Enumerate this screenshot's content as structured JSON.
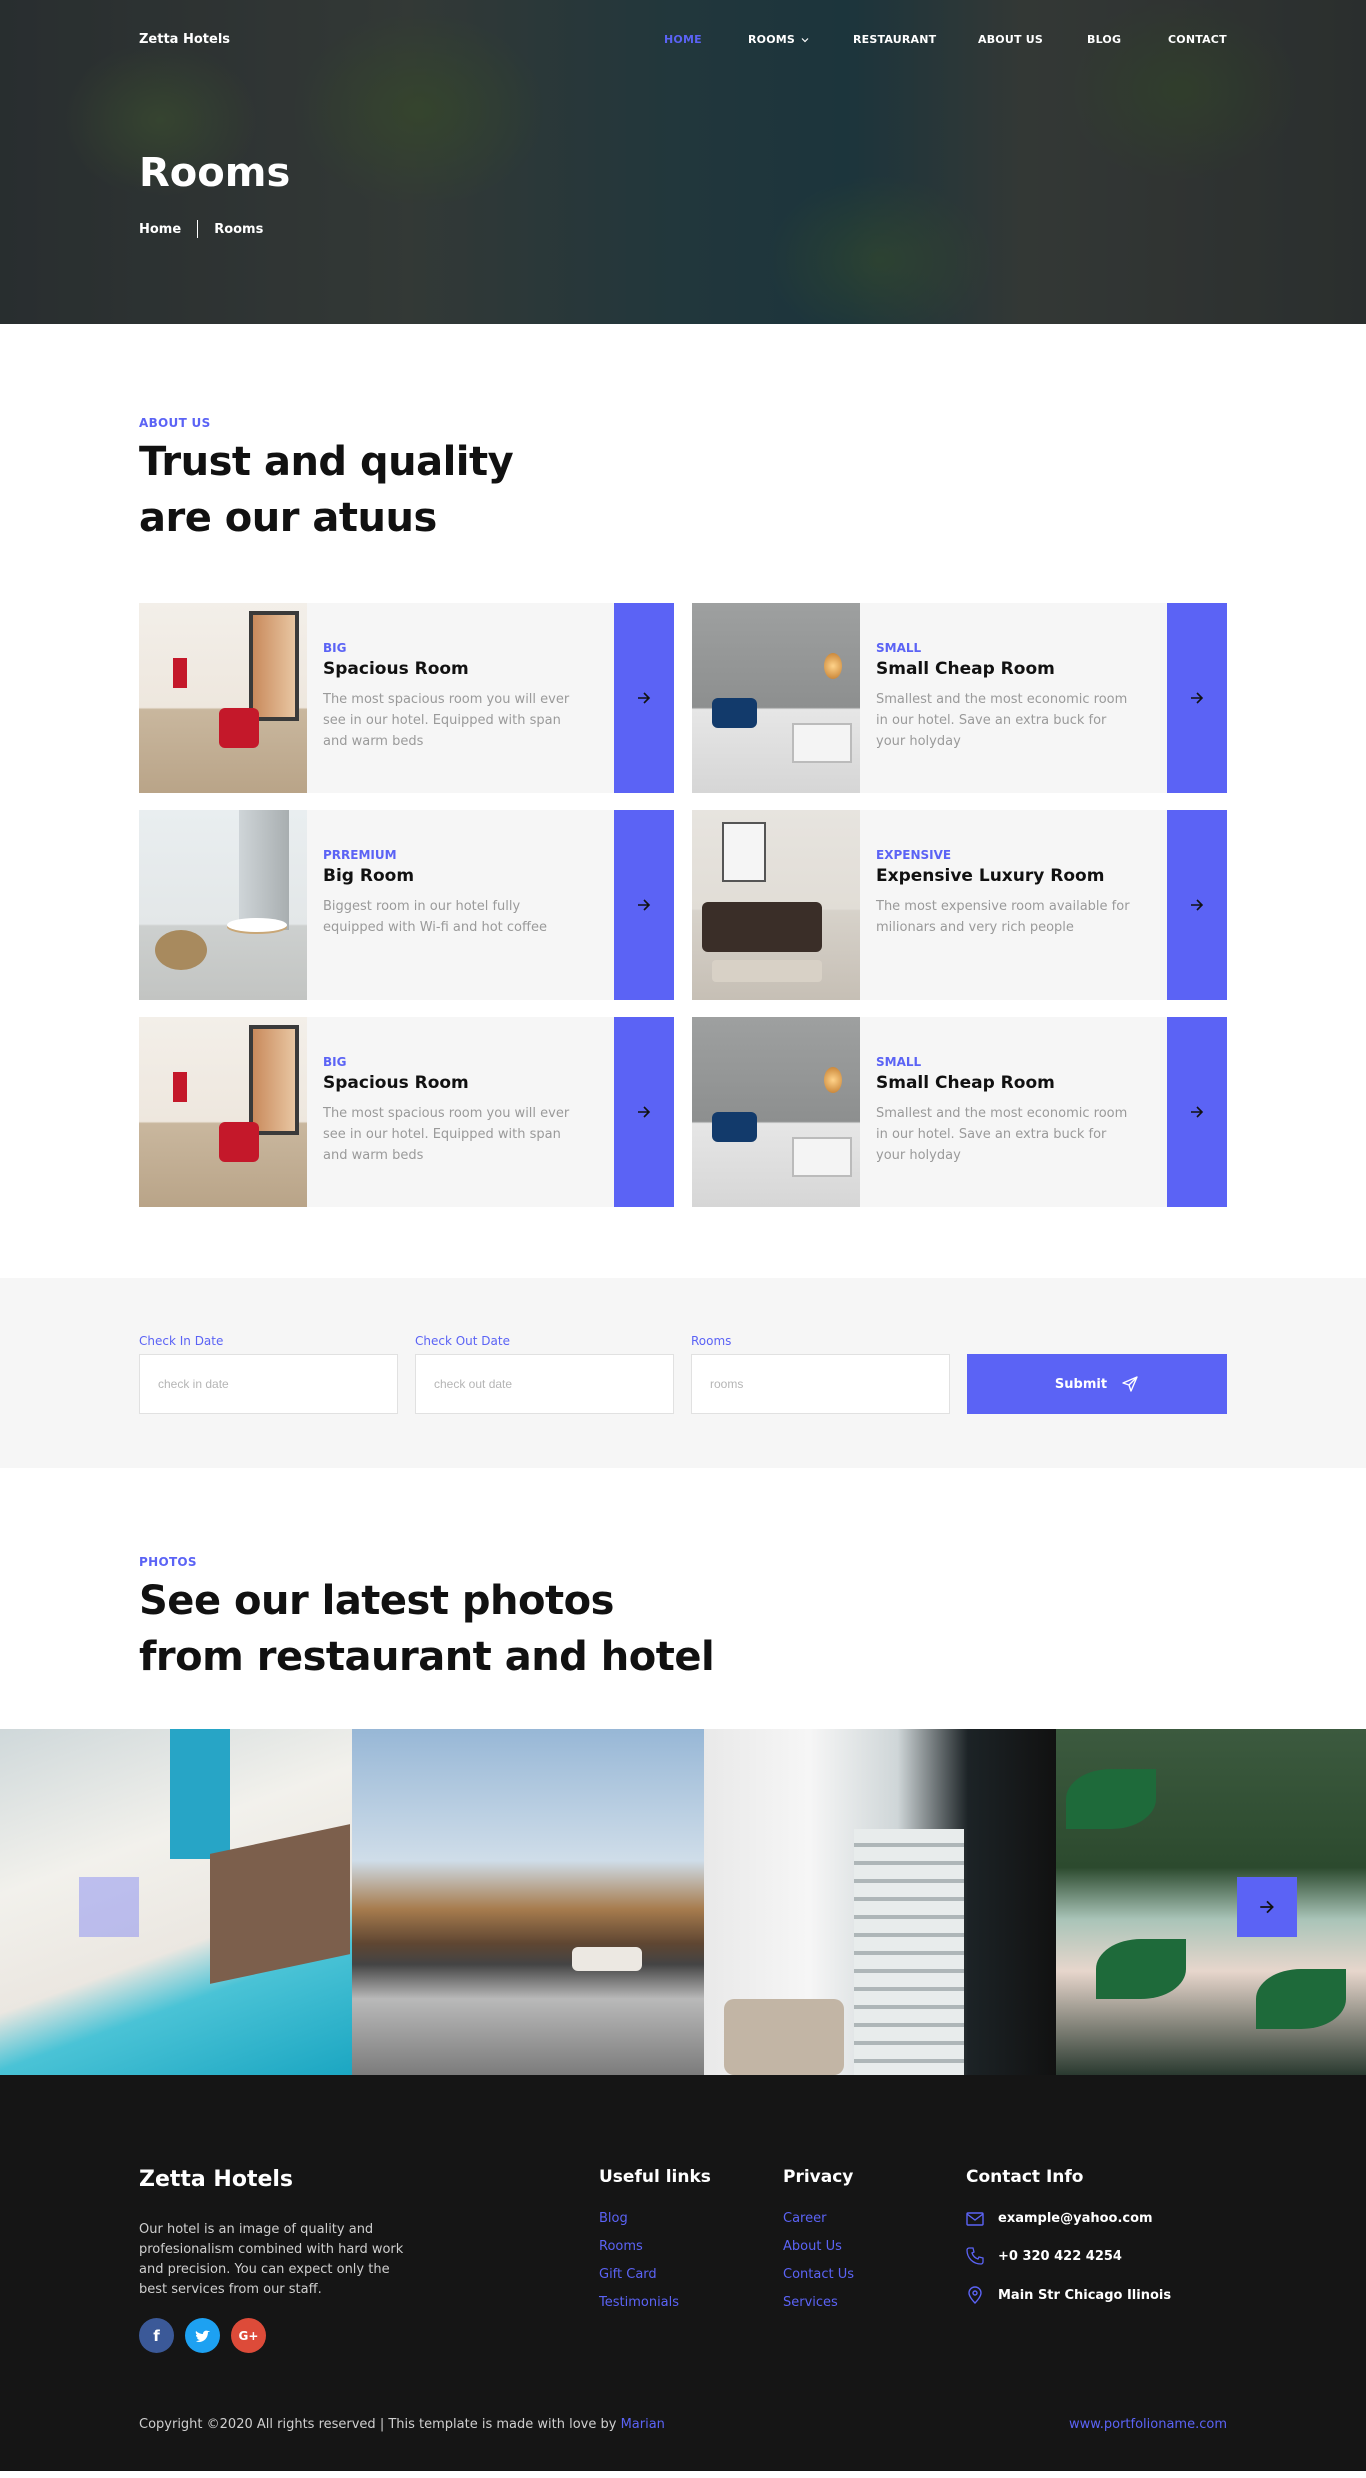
{
  "nav": {
    "brand": "Zetta Hotels",
    "items": [
      "HOME",
      "ROOMS",
      "RESTAURANT",
      "ABOUT US",
      "BLOG",
      "CONTACT"
    ]
  },
  "hero": {
    "title": "Rooms",
    "breadcrumb": [
      "Home",
      "Rooms"
    ]
  },
  "about": {
    "eyebrow": "ABOUT US",
    "title_line1": "Trust and quality",
    "title_line2": "are our atuus"
  },
  "rooms": [
    {
      "tag": "BIG",
      "title": "Spacious Room",
      "desc": "The most spacious room you will ever see in our hotel. Equipped with span and warm beds"
    },
    {
      "tag": "SMALL",
      "title": "Small Cheap Room",
      "desc": "Smallest and the most economic room in our hotel. Save an extra buck for your holyday"
    },
    {
      "tag": "PRREMIUM",
      "title": "Big Room",
      "desc": "Biggest room in our hotel fully equipped with Wi-fi and hot coffee"
    },
    {
      "tag": "EXPENSIVE",
      "title": "Expensive Luxury Room",
      "desc": "The most expensive room available for milionars and very rich people"
    },
    {
      "tag": "BIG",
      "title": "Spacious Room",
      "desc": "The most spacious room you will ever see in our hotel. Equipped with span and warm beds"
    },
    {
      "tag": "SMALL",
      "title": "Small Cheap Room",
      "desc": "Smallest and the most economic room in our hotel. Save an extra buck for your holyday"
    }
  ],
  "booking": {
    "checkin_label": "Check In Date",
    "checkin_placeholder": "check in date",
    "checkout_label": "Check Out Date",
    "checkout_placeholder": "check out date",
    "rooms_label": "Rooms",
    "rooms_placeholder": "rooms",
    "submit": "Submit"
  },
  "photos": {
    "eyebrow": "PHOTOS",
    "title_line1": "See our latest photos",
    "title_line2": "from restaurant and hotel"
  },
  "footer": {
    "brand": "Zetta Hotels",
    "about": "Our hotel is an image of quality and profesionalism combined with hard work and precision. You can expect only the best services from our staff.",
    "useful_title": "Useful links",
    "useful": [
      "Blog",
      "Rooms",
      "Gift Card",
      "Testimonials"
    ],
    "privacy_title": "Privacy",
    "privacy": [
      "Career",
      "About Us",
      "Contact Us",
      "Services"
    ],
    "contact_title": "Contact Info",
    "email": "example@yahoo.com",
    "phone": "+0 320 422 4254",
    "address": "Main Str Chicago Ilinois",
    "copyright": "Copyright ©2020 All rights reserved | This template is made with love by ",
    "author": "Marian",
    "portfolio": "www.portfolioname.com"
  },
  "colors": {
    "accent": "#5b63f5",
    "footer_bg": "#151515",
    "section_bg": "#f6f6f6"
  }
}
